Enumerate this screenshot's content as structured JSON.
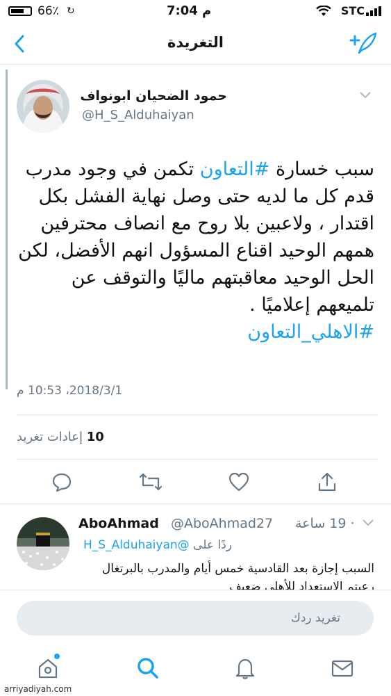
{
  "status": {
    "carrier": "STC",
    "time": "7:04 م",
    "battery": "66٪"
  },
  "nav": {
    "title": "التغريدة"
  },
  "tweet": {
    "author_name": "حمود الضحيان ابونواف",
    "handle": "@H_S_Alduhaiyan",
    "text_lines": [
      [
        "سبب خسارة ",
        "#التعاون",
        " تكمن في وجود مدرب"
      ],
      [
        "قدم كل ما لديه حتى وصل نهاية الفشل بكل"
      ],
      [
        "اقتدار ، ولاعبين بلا روح مع انصاف محترفين"
      ],
      [
        "همهم الوحيد اقناع المسؤول انهم الأفضل، لكن"
      ],
      [
        "الحل الوحيد معاقبتهم ماليًا والتوقف عن"
      ],
      [
        "تلميعهم إعلاميًا ."
      ],
      [
        "",
        "#الاهلي_التعاون",
        ""
      ]
    ],
    "date": "2018/3/1، 10:53 م",
    "retweet_count": "10",
    "retweet_label": "إعادات تغريد"
  },
  "reply": {
    "name": "AboAhmad",
    "handle": "@AboAhmad27",
    "time": "· 19 ساعة",
    "replying_to_label": "ردًا على",
    "replying_to_handle": "@H_S_Alduhaiyan",
    "text": "السبب إجازة بعد القادسية خمس أيام والمدرب بالبرتغال رعيتم الاستعداد للأهلي ضعيف"
  },
  "compose": {
    "placeholder": "تغريد ردك"
  },
  "watermark": "arriyadiyah.com",
  "colors": {
    "accent": "#1da1f2"
  }
}
